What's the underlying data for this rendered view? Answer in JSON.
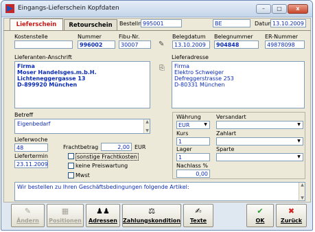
{
  "window": {
    "title": "Eingangs-Lieferschein Kopfdaten",
    "minimize": "–",
    "maximize": "□",
    "close": "x"
  },
  "tabs": [
    {
      "label": "Lieferschein"
    },
    {
      "label": "Retourschein"
    }
  ],
  "header": {
    "bestellnr_label": "Bestellnr.",
    "bestellnr_value": "995001",
    "code_value": "BE",
    "datum_label": "Datum",
    "datum_value": "13.10.2009"
  },
  "row1": {
    "kostenstelle_label": "Kostenstelle",
    "kostenstelle_value": "",
    "nummer_label": "Nummer",
    "nummer_value": "996002",
    "fibu_label": "Fibu-Nr.",
    "fibu_value": "30007",
    "belegdatum_label": "Belegdatum",
    "belegdatum_value": "13.10.2009",
    "belegnummer_label": "Belegnummer",
    "belegnummer_value": "904848",
    "ernummer_label": "ER-Nummer",
    "ernummer_value": "49878098"
  },
  "lieferanten": {
    "label": "Lieferanten-Anschrift",
    "lines": [
      "Firma",
      "Moser Handelsges.m.b.H.",
      "Lichteneggergasse 13",
      "D-899920 München"
    ]
  },
  "lieferadresse": {
    "label": "Lieferadresse",
    "lines": [
      "Firma",
      "Elektro Schweiger",
      "Defreggerstrasse 253",
      "D-80331 München"
    ]
  },
  "betreff": {
    "label": "Betreff",
    "value": "Eigenbedarf"
  },
  "lieferwoche": {
    "label": "Lieferwoche",
    "value": "48"
  },
  "liefertermin": {
    "label": "Liefertermin",
    "value": "23.11.2009"
  },
  "frachtbetrag": {
    "label": "Frachtbetrag",
    "value": "2,00",
    "currency": "EUR"
  },
  "checkboxes": {
    "sonstige": "sonstige Frachtkosten",
    "preiswartung": "keine Preiswartung",
    "mwst": "Mwst"
  },
  "right_group": {
    "waehrung_label": "Währung",
    "waehrung_value": "EUR",
    "versandart_label": "Versandart",
    "versandart_value": "",
    "kurs_label": "Kurs",
    "kurs_value": "1",
    "zahlart_label": "Zahlart",
    "zahlart_value": "",
    "lager_label": "Lager",
    "lager_value": "1",
    "sparte_label": "Sparte",
    "sparte_value": "",
    "nachlass_label": "Nachlass %",
    "nachlass_value": "0,00"
  },
  "text_block": "Wir bestellen zu Ihren Geschäftsbedingungen folgende Artikel:",
  "toolbar": {
    "aendern": "Ändern",
    "positionen": "Positionen",
    "adressen": "Adressen",
    "zahlungskondition": "Zahlungskondition",
    "texte": "Texte",
    "ok": "OK",
    "zurueck": "Zurück"
  },
  "colors": {
    "field_text": "#0a2bb5",
    "active_tab": "#c71b1b",
    "ok_green": "#2c9a2c",
    "cancel_red": "#d02020"
  }
}
